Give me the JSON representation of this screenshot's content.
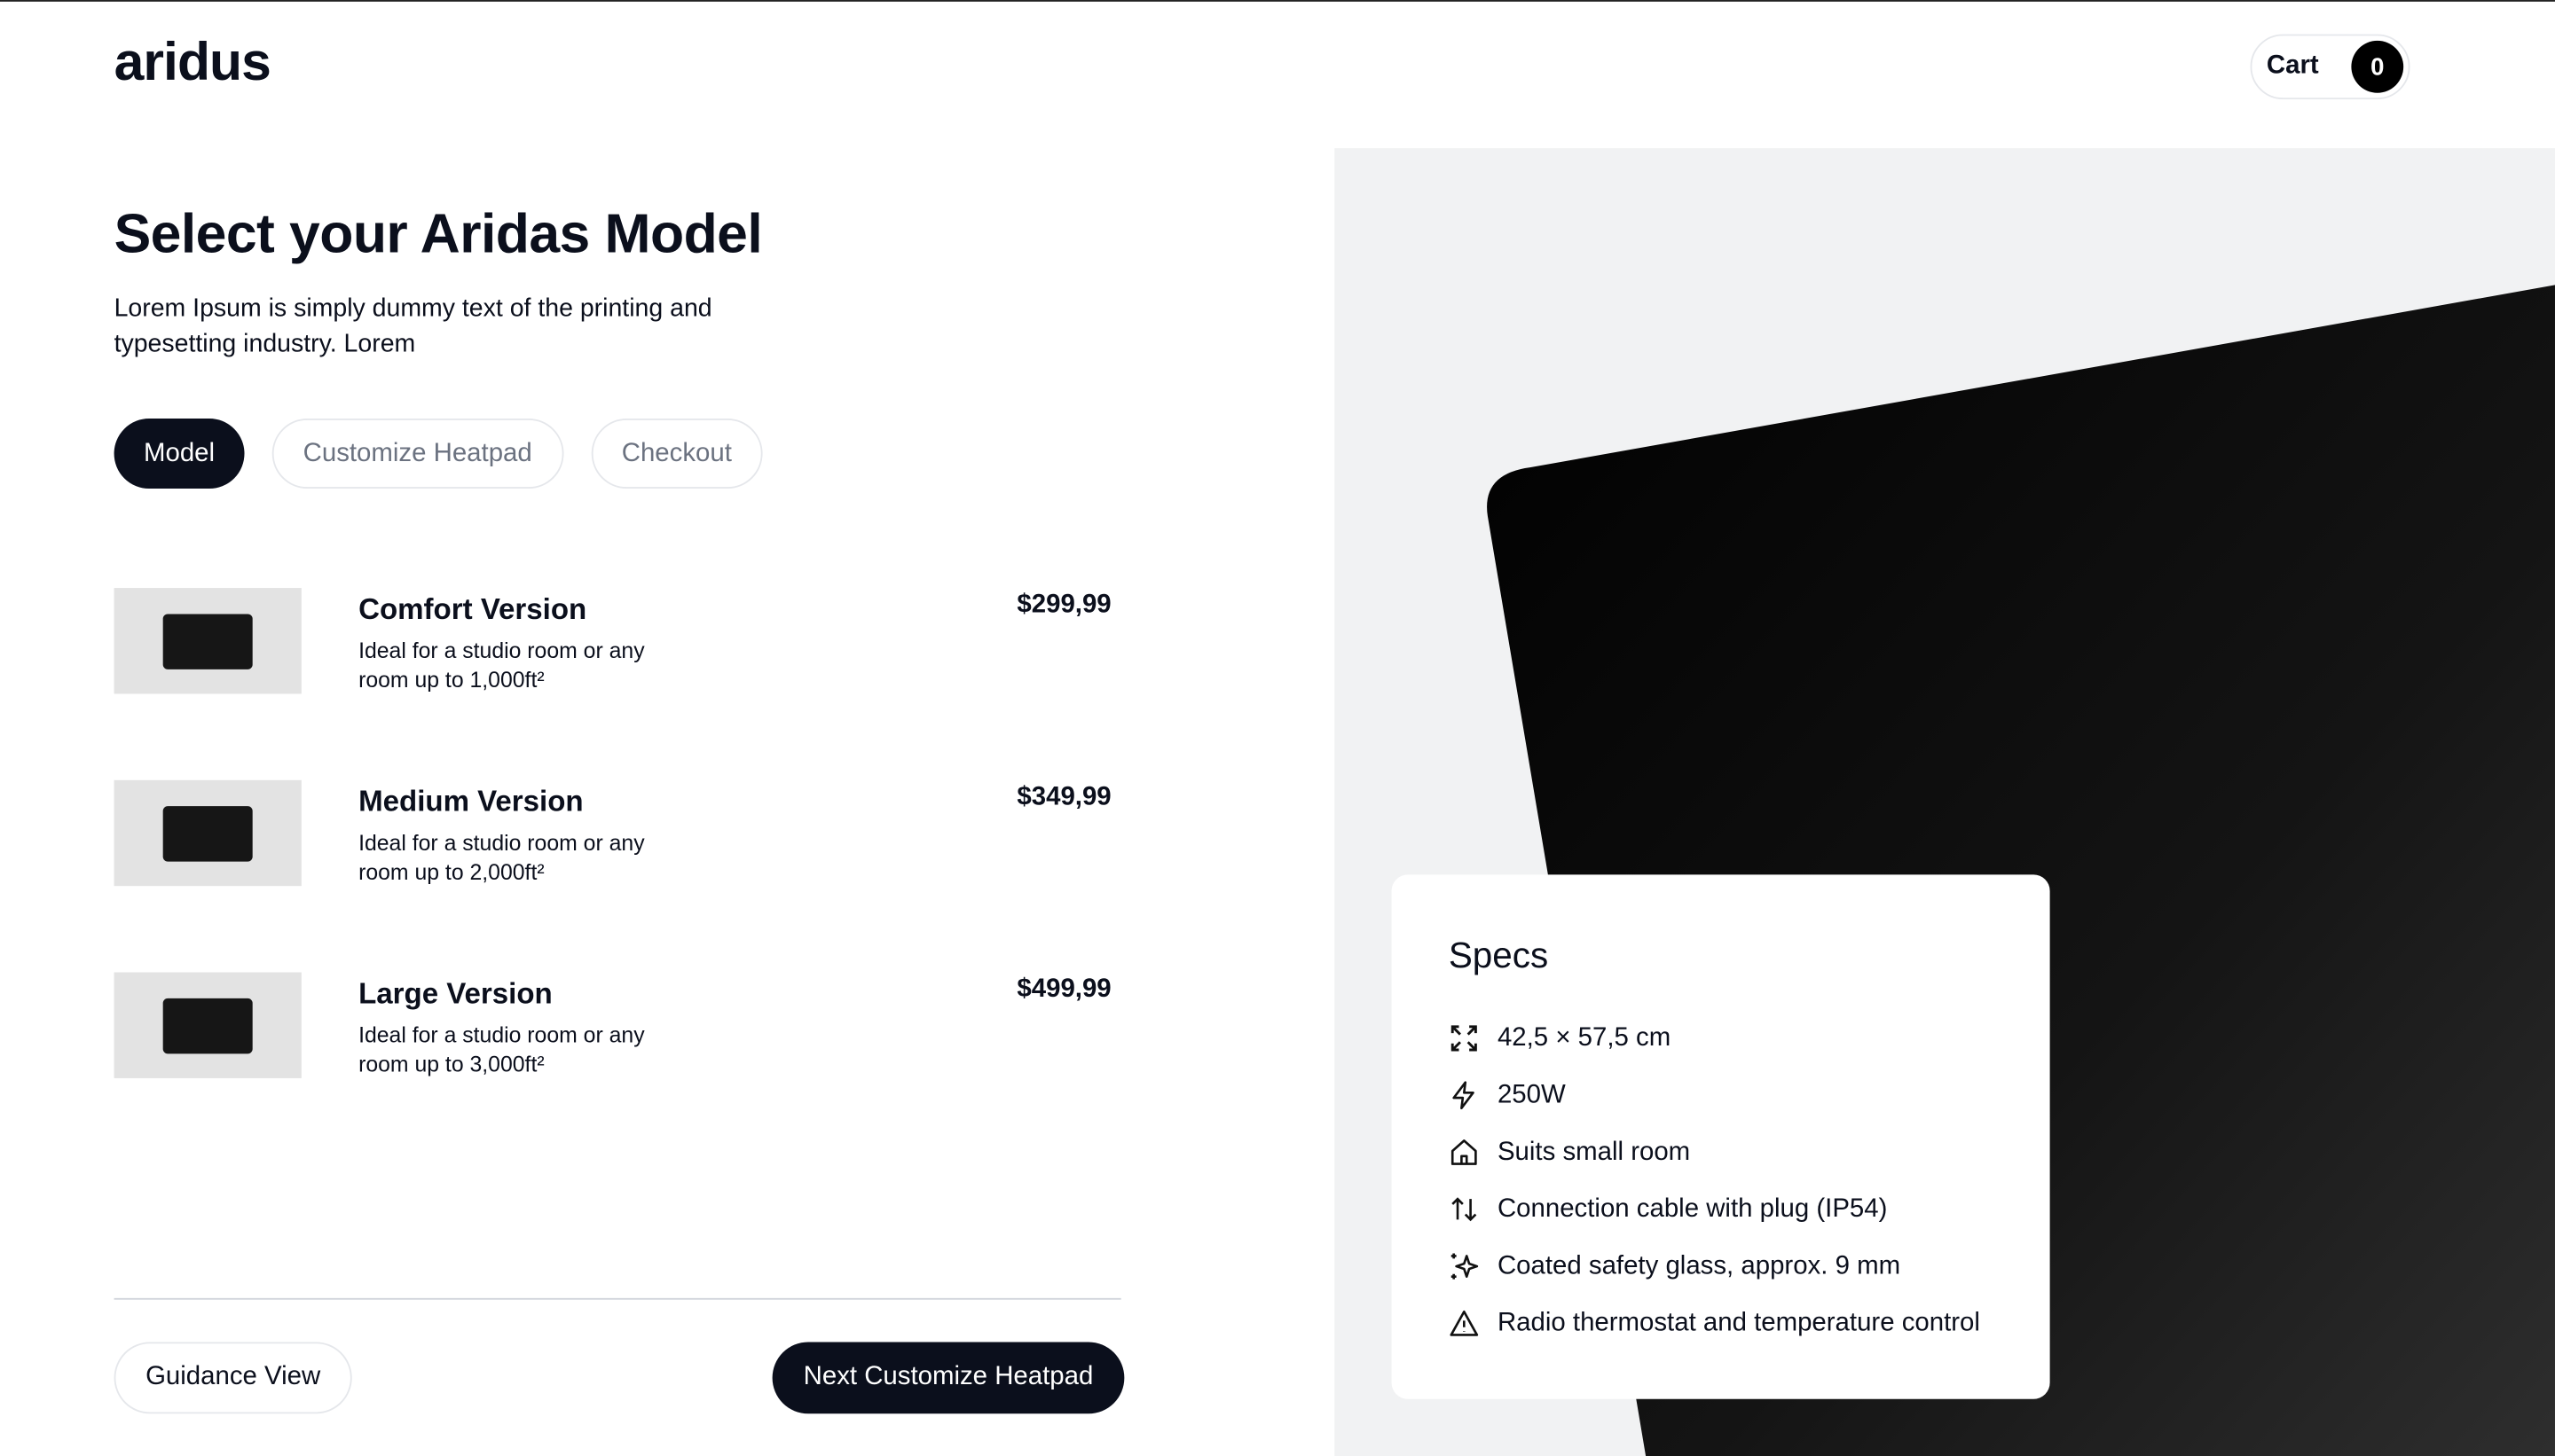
{
  "header": {
    "logo": "aridus",
    "cart_label": "Cart",
    "cart_count": "0"
  },
  "main": {
    "title": "Select your Aridas Model",
    "intro": "Lorem Ipsum is simply dummy text of the printing and typesetting industry. Lorem",
    "tabs": [
      {
        "label": "Model",
        "active": true
      },
      {
        "label": "Customize Heatpad",
        "active": false
      },
      {
        "label": "Checkout",
        "active": false
      }
    ],
    "models": [
      {
        "name": "Comfort Version",
        "desc": "Ideal for a studio room or any room up to 1,000ft²",
        "price": "$299,99"
      },
      {
        "name": "Medium Version",
        "desc": "Ideal for a studio room or any room up to 2,000ft²",
        "price": "$349,99"
      },
      {
        "name": "Large Version",
        "desc": "Ideal for a studio room or any room up to 3,000ft²",
        "price": "$499,99"
      }
    ],
    "guidance_label": "Guidance View",
    "next_label": "Next Customize Heatpad"
  },
  "specs": {
    "title": "Specs",
    "items": [
      {
        "icon": "expand-icon",
        "text": "42,5 × 57,5 cm"
      },
      {
        "icon": "lightning-icon",
        "text": "250W"
      },
      {
        "icon": "home-icon",
        "text": "Suits small room"
      },
      {
        "icon": "arrows-up-down-icon",
        "text": "Connection cable with plug (IP54)"
      },
      {
        "icon": "sparkles-icon",
        "text": "Coated safety glass, approx. 9 mm"
      },
      {
        "icon": "warning-icon",
        "text": "Radio thermostat and temperature control"
      }
    ]
  }
}
